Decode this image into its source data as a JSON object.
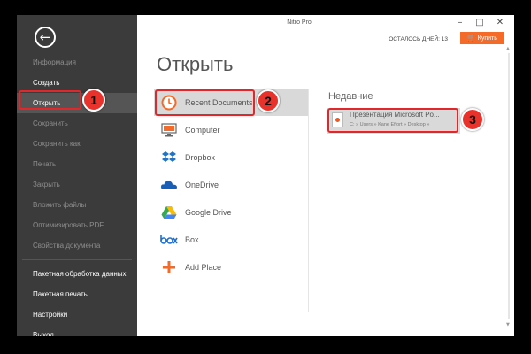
{
  "window": {
    "title": "Nitro Pro"
  },
  "title_bar": {
    "trial_text": "ОСТАЛОСЬ ДНЕЙ: 13",
    "buy_label": "Купить"
  },
  "sidebar": {
    "items": [
      {
        "label": "Информация",
        "state": "disabled"
      },
      {
        "label": "Создать",
        "state": "enabled"
      },
      {
        "label": "Открыть",
        "state": "active"
      },
      {
        "label": "Сохранить",
        "state": "disabled"
      },
      {
        "label": "Сохранить как",
        "state": "disabled"
      },
      {
        "label": "Печать",
        "state": "disabled"
      },
      {
        "label": "Закрыть",
        "state": "disabled"
      },
      {
        "label": "Вложить файлы",
        "state": "disabled"
      },
      {
        "label": "Оптимизировать PDF",
        "state": "disabled"
      },
      {
        "label": "Свойства документа",
        "state": "disabled"
      }
    ],
    "bottom_items": [
      {
        "label": "Пакетная обработка данных"
      },
      {
        "label": "Пакетная печать"
      },
      {
        "label": "Настройки"
      },
      {
        "label": "Выход"
      }
    ]
  },
  "main": {
    "title": "Открыть",
    "places": [
      {
        "label": "Recent Documents",
        "icon": "recent-clock-icon",
        "active": true
      },
      {
        "label": "Computer",
        "icon": "computer-icon"
      },
      {
        "label": "Dropbox",
        "icon": "dropbox-icon"
      },
      {
        "label": "OneDrive",
        "icon": "onedrive-icon"
      },
      {
        "label": "Google Drive",
        "icon": "google-drive-icon"
      },
      {
        "label": "Box",
        "icon": "box-icon"
      },
      {
        "label": "Add Place",
        "icon": "add-place-icon"
      }
    ],
    "recent": {
      "heading": "Недавние",
      "items": [
        {
          "name": "Презентация Microsoft Po...",
          "path": "C: » Users » Kane Effort » Desktop »"
        }
      ]
    }
  },
  "annotations": {
    "badges": [
      "1",
      "2",
      "3"
    ]
  },
  "colors": {
    "accent": "#f46a28",
    "sidebar_bg": "#3b3b3b",
    "callout": "#e2272b"
  }
}
